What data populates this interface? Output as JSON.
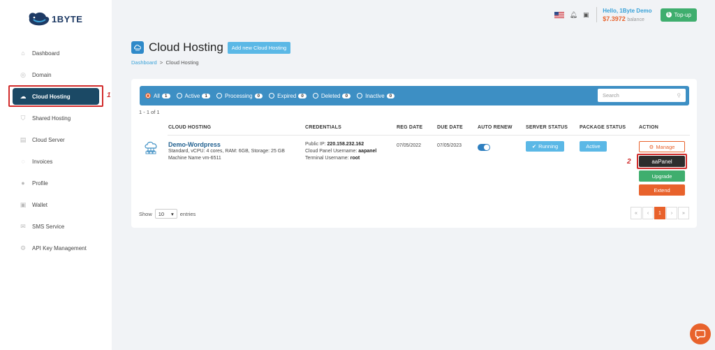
{
  "brand": {
    "logo_text": "1BYTE"
  },
  "sidebar": {
    "items": [
      {
        "label": "Dashboard",
        "icon": "home-icon"
      },
      {
        "label": "Domain",
        "icon": "globe-icon"
      },
      {
        "label": "Cloud Hosting",
        "icon": "cloud-icon",
        "active": true
      },
      {
        "label": "Shared Hosting",
        "icon": "shield-icon"
      },
      {
        "label": "Cloud Server",
        "icon": "server-icon"
      },
      {
        "label": "Invoices",
        "icon": "invoice-icon"
      },
      {
        "label": "Profile",
        "icon": "user-icon"
      },
      {
        "label": "Wallet",
        "icon": "wallet-icon"
      },
      {
        "label": "SMS Service",
        "icon": "sms-icon"
      },
      {
        "label": "API Key Management",
        "icon": "key-icon"
      }
    ]
  },
  "header": {
    "greeting": "Hello, 1Byte Demo",
    "balance": "$7.3972",
    "balance_suffix": "balance",
    "topup_label": "Top-up"
  },
  "page": {
    "title": "Cloud Hosting",
    "add_button": "Add new Cloud Hosting",
    "breadcrumb_home": "Dashboard",
    "breadcrumb_sep": ">",
    "breadcrumb_current": "Cloud Hosting"
  },
  "filters": [
    {
      "label": "All",
      "count": "1",
      "selected": true
    },
    {
      "label": "Active",
      "count": "1"
    },
    {
      "label": "Processing",
      "count": "0"
    },
    {
      "label": "Expired",
      "count": "0"
    },
    {
      "label": "Deleted",
      "count": "0"
    },
    {
      "label": "Inactive",
      "count": "0"
    }
  ],
  "search": {
    "placeholder": "Search"
  },
  "range_text": "1 - 1 of 1",
  "table": {
    "headers": [
      "CLOUD HOSTING",
      "CREDENTIALS",
      "REG DATE",
      "DUE DATE",
      "AUTO RENEW",
      "SERVER STATUS",
      "PACKAGE STATUS",
      "ACTION"
    ],
    "row": {
      "name": "Demo-Wordpress",
      "spec": "Standard, vCPU: 4 cores, RAM: 6GB, Storage: 25 GB",
      "machine": "Machine Name vm-6511",
      "ip_label": "Public IP:",
      "ip": "220.158.232.162",
      "cp_label": "Cloud Panel Username:",
      "cp_user": "aapanel",
      "term_label": "Terminal Username:",
      "term_user": "root",
      "reg_date": "07/05/2022",
      "due_date": "07/05/2023",
      "auto_renew": true,
      "server_status": "Running",
      "package_status": "Active",
      "actions": {
        "manage": "Manage",
        "apanel": "aaPanel",
        "upgrade": "Upgrade",
        "extend": "Extend"
      }
    }
  },
  "footer": {
    "show_label": "Show",
    "page_size": "10",
    "entries_label": "entries",
    "pager": [
      "«",
      "‹",
      "1",
      "›",
      "»"
    ],
    "current_page": "1"
  },
  "annotations": [
    "1",
    "2"
  ],
  "colors": {
    "primary": "#1b4965",
    "accent": "#e8622c",
    "filter_bar": "#3d8fc4",
    "success": "#3fae6e"
  }
}
